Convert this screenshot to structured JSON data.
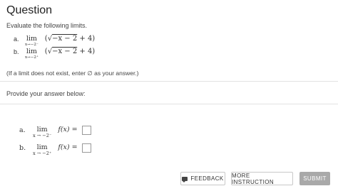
{
  "header": {
    "title": "Question"
  },
  "question": {
    "intro": "Evaluate the following limits.",
    "parts": [
      {
        "label": "a.",
        "lim": "lim",
        "sub": "x→−2⁻",
        "open": "(√",
        "radicand": "−x − 2",
        "close": "+ 4)"
      },
      {
        "label": "b.",
        "lim": "lim",
        "sub": "x→−2⁺",
        "open": "(√",
        "radicand": "−x − 2",
        "close": "+ 4)"
      }
    ],
    "note": "(If a limit does not exist, enter ∅ as your answer.)"
  },
  "answer": {
    "prompt": "Provide your answer below:",
    "rows": [
      {
        "label": "a.",
        "lim": "lim",
        "sub": "x → −2⁻",
        "fx": "f(x)",
        "eq": "=",
        "value": ""
      },
      {
        "label": "b.",
        "lim": "lim",
        "sub": "x → −2⁺",
        "fx": "f(x)",
        "eq": "=",
        "value": ""
      }
    ]
  },
  "buttons": {
    "feedback": "FEEDBACK",
    "more_instruction": "MORE INSTRUCTION",
    "submit": "SUBMIT"
  },
  "icons": {
    "feedback": "speech-bubble-icon"
  },
  "colors": {
    "submit_bg": "#a9a9a9",
    "divider": "#e2e2e2"
  }
}
